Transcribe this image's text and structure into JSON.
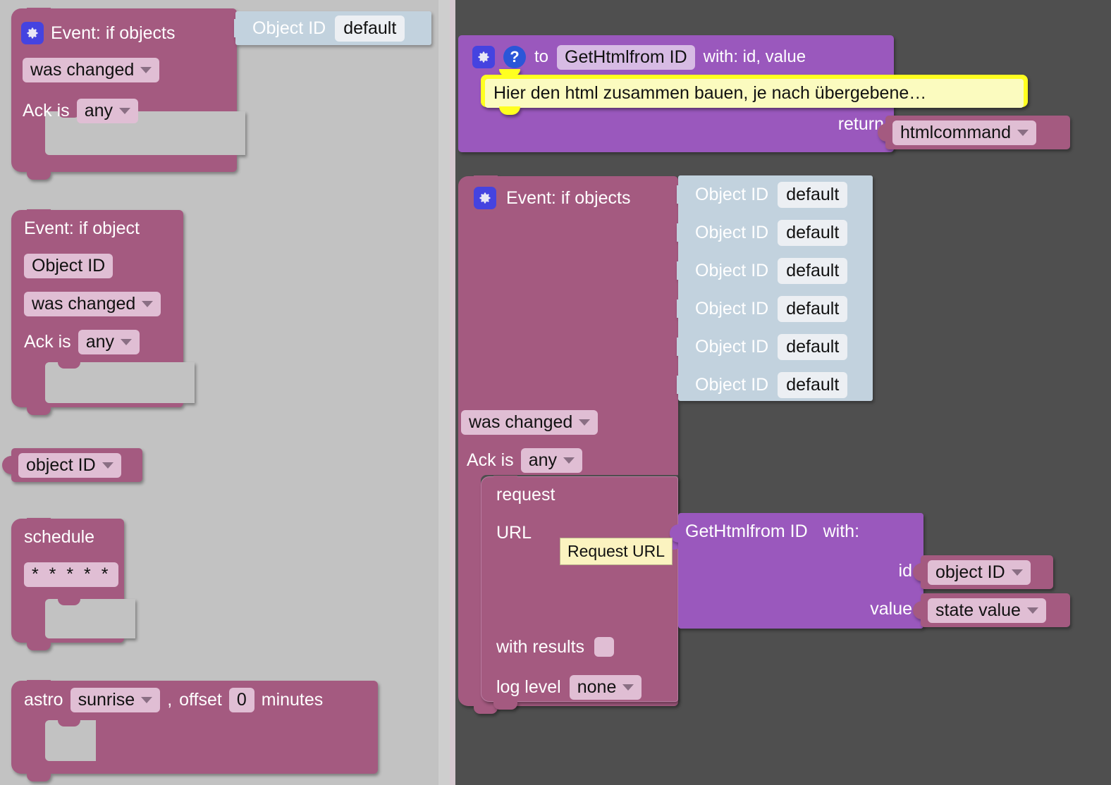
{
  "workspace": {
    "flyout_background": "#c2c2c2",
    "canvas_background": "#4f4f4f"
  },
  "flyout_blocks": [
    {
      "id": "event-objects-flyout",
      "title": "Event: if objects",
      "gear_icon": "gear-icon",
      "trigger_label": "was changed",
      "ack_prefix": "Ack is",
      "ack_value": "any",
      "object_rows": [
        {
          "label": "Object ID",
          "value": "default"
        }
      ]
    },
    {
      "id": "event-object-flyout",
      "title": "Event: if object",
      "objectid_field": "Object ID",
      "trigger_label": "was changed",
      "ack_prefix": "Ack is",
      "ack_value": "any"
    },
    {
      "id": "objectid-getter-flyout",
      "value": "object ID"
    },
    {
      "id": "schedule-flyout",
      "title": "schedule",
      "cron": "* * * * *"
    },
    {
      "id": "astro-flyout",
      "prefix": "astro",
      "event": "sunrise",
      "separator": ",",
      "offset_label": "offset",
      "offset_value": "0",
      "unit_label": "minutes"
    }
  ],
  "canvas_blocks": {
    "procedure_definition": {
      "gear_icon": "gear-icon",
      "help_icon": "help-icon",
      "to_label": "to",
      "name": "GetHtmlfrom ID",
      "with_label": "with: id, value",
      "comment": "Hier den html zusammen bauen, je nach übergebene…",
      "return_label": "return",
      "return_value": "htmlcommand"
    },
    "event_trigger": {
      "gear_icon": "gear-icon",
      "title": "Event: if objects",
      "trigger_label": "was changed",
      "ack_prefix": "Ack is",
      "ack_value": "any",
      "object_rows": [
        {
          "label": "Object ID",
          "value": "default"
        },
        {
          "label": "Object ID",
          "value": "default"
        },
        {
          "label": "Object ID",
          "value": "default"
        },
        {
          "label": "Object ID",
          "value": "default"
        },
        {
          "label": "Object ID",
          "value": "default"
        },
        {
          "label": "Object ID",
          "value": "default"
        }
      ]
    },
    "request_block": {
      "title": "request",
      "url_label": "URL",
      "with_results_label": "with results",
      "with_results_checked": false,
      "log_level_label": "log level",
      "log_level_value": "none"
    },
    "procedure_call": {
      "name": "GetHtmlfrom ID",
      "with_label": "with:",
      "args": [
        {
          "name": "id",
          "value": "object ID"
        },
        {
          "name": "value",
          "value": "state value"
        }
      ]
    },
    "tooltip": {
      "text": "Request URL"
    }
  },
  "colors": {
    "block_pink": "#a45a80",
    "field_pink": "#e0bed4",
    "procedure_purple": "#9a58bd",
    "field_lilac": "#d7bbe4",
    "objectid_panel": "#c2d2de",
    "comment_yellow": "#ffff20",
    "comment_inner": "#fbfbbf",
    "tooltip_yellow": "#fbf3c0",
    "icon_blue": "#4543e0"
  }
}
